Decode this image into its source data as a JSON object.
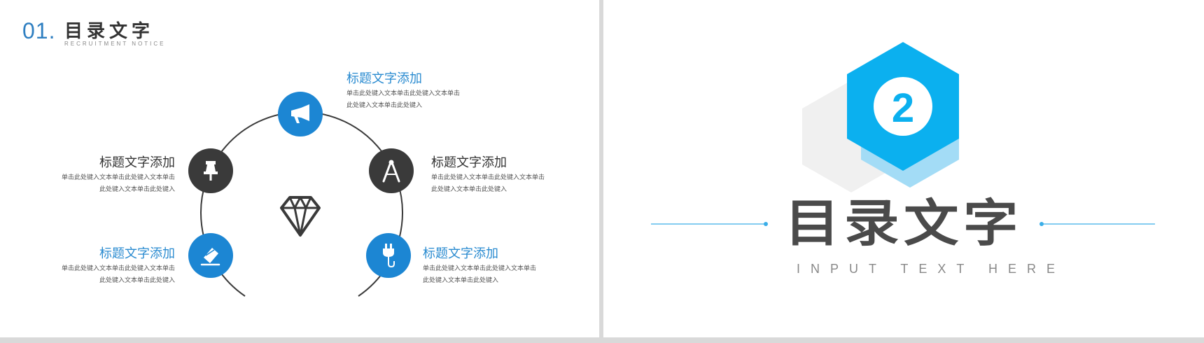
{
  "left_slide": {
    "section_number": "01.",
    "section_title": "目录文字",
    "section_subtitle": "RECRUITMENT NOTICE",
    "items": [
      {
        "title": "标题文字添加",
        "desc1": "单击此处键入文本单击此处键入文本单击",
        "desc2": "此处键入文本单击此处键入"
      },
      {
        "title": "标题文字添加",
        "desc1": "单击此处键入文本单击此处键入文本单击",
        "desc2": "此处键入文本单击此处键入"
      },
      {
        "title": "标题文字添加",
        "desc1": "单击此处键入文本单击此处键入文本单击",
        "desc2": "此处键入文本单击此处键入"
      },
      {
        "title": "标题文字添加",
        "desc1": "单击此处键入文本单击此处键入文本单击",
        "desc2": "此处键入文本单击此处键入"
      },
      {
        "title": "标题文字添加",
        "desc1": "单击此处键入文本单击此处键入文本单击",
        "desc2": "此处键入文本单击此处键入"
      }
    ],
    "icons": [
      "megaphone-icon",
      "pushpin-icon",
      "compass-icon",
      "eraser-icon",
      "plug-icon",
      "diamond-icon"
    ]
  },
  "right_slide": {
    "number": "2",
    "title": "目录文字",
    "tagline": "INPUT TEXT HERE"
  },
  "colors": {
    "accent_blue": "#1c86d3",
    "hex_blue": "#0bb0ef",
    "hex_light_blue": "#a3dcf6",
    "hex_gray": "#f0f0f0",
    "dark_circle": "#3a3a3a",
    "big_title": "#4a4a4a"
  }
}
